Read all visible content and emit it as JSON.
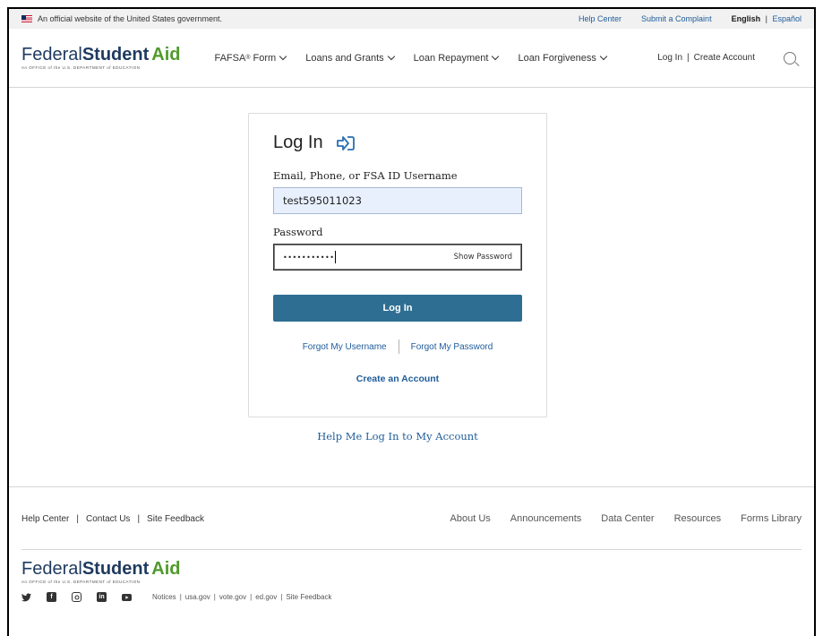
{
  "gov_banner": {
    "text": "An official website of the United States government.",
    "help_center": "Help Center",
    "submit_complaint": "Submit a Complaint",
    "lang_en": "English",
    "lang_sep": "|",
    "lang_es": "Español"
  },
  "logo": {
    "federal": "Federal",
    "student": "Student",
    "aid": "Aid",
    "tagline": "An OFFICE of the U.S. DEPARTMENT of EDUCATION"
  },
  "nav": {
    "fafsa": "FAFSA",
    "fafsa_reg": "®",
    "fafsa_form": " Form",
    "loans_grants": "Loans and Grants",
    "loan_repayment": "Loan Repayment",
    "loan_forgiveness": "Loan Forgiveness",
    "log_in": "Log In",
    "sep": "|",
    "create_account": "Create Account"
  },
  "login": {
    "title": "Log In",
    "username_label": "Email, Phone, or FSA ID Username",
    "username_value": "test595011023",
    "password_label": "Password",
    "password_mask": "•••••••••••",
    "show_password": "Show Password",
    "submit": "Log In",
    "forgot_username": "Forgot My Username",
    "forgot_password": "Forgot My Password",
    "create_account": "Create an Account",
    "help": "Help Me Log In to My Account"
  },
  "footer": {
    "help_center": "Help Center",
    "contact_us": "Contact Us",
    "site_feedback": "Site Feedback",
    "bar": "|",
    "about_us": "About Us",
    "announcements": "Announcements",
    "data_center": "Data Center",
    "resources": "Resources",
    "forms_library": "Forms Library",
    "social_icons": [
      "twitter-icon",
      "facebook-icon",
      "instagram-icon",
      "linkedin-icon",
      "youtube-icon"
    ],
    "legal": {
      "notices": "Notices",
      "usagov": "usa.gov",
      "votegov": "vote.gov",
      "edgov": "ed.gov",
      "site_feedback": "Site Feedback"
    }
  },
  "colors": {
    "primary_button": "#2d6e92",
    "link": "#1f5c99",
    "brand_green": "#4f9a2c",
    "brand_navy": "#1f3a5f"
  }
}
